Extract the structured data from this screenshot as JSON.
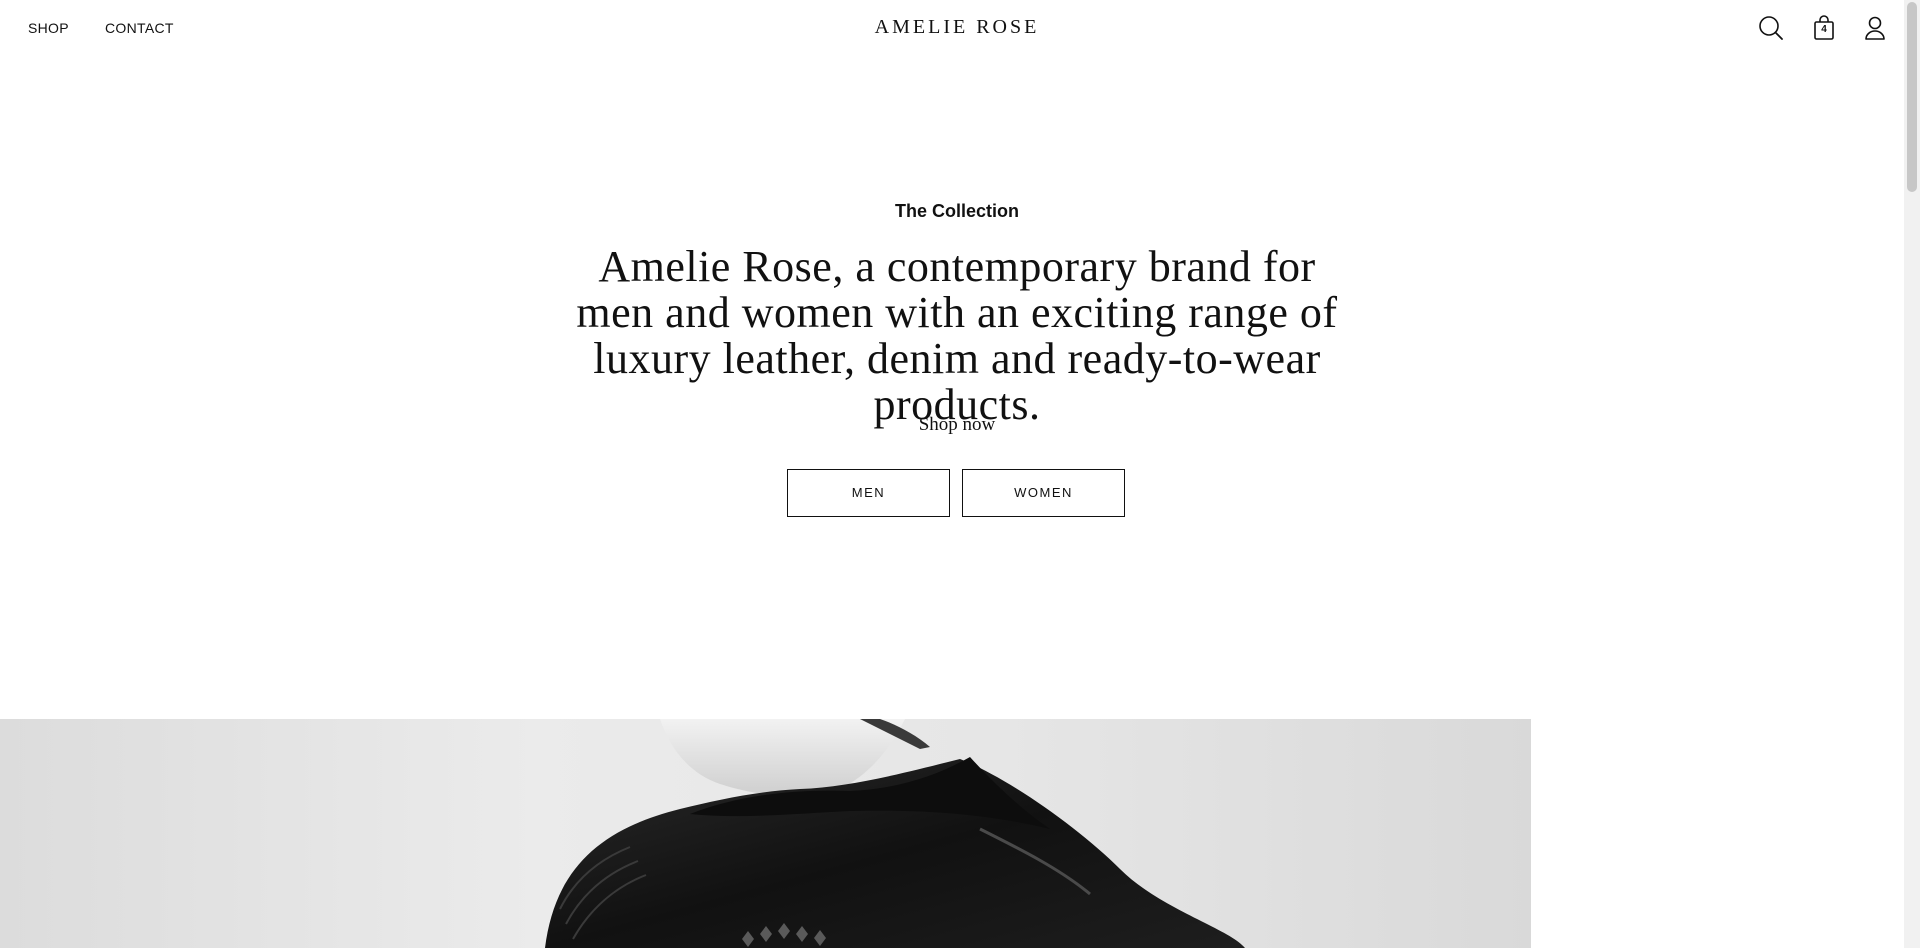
{
  "header": {
    "nav": {
      "shop_label": "SHOP",
      "contact_label": "CONTACT"
    },
    "logo_text": "AMELIE ROSE",
    "icons": {
      "search": "search-icon",
      "bag": "shopping-bag-icon",
      "account": "user-icon"
    },
    "bag_count": "4"
  },
  "hero": {
    "eyebrow": "The Collection",
    "headline": "Amelie Rose, a contemporary brand for men and women with an exciting range of luxury leather, denim and ready-to-wear products.",
    "shop_now": "Shop now",
    "buttons": {
      "men_label": "MEN",
      "women_label": "WOMEN"
    }
  },
  "colors": {
    "text": "#111111",
    "background": "#ffffff",
    "hero_background": "#e6e6e6",
    "jacket": "#1a1a1a"
  }
}
